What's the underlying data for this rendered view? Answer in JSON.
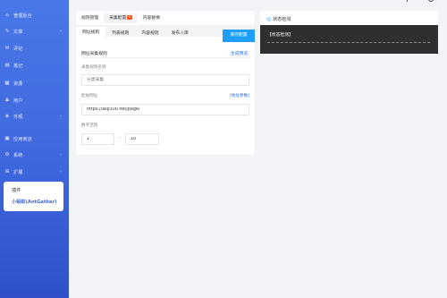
{
  "sidebar": {
    "items": [
      {
        "icon": "home-icon",
        "glyph": "⌂",
        "label": "管理后台"
      },
      {
        "icon": "pencil-icon",
        "glyph": "✎",
        "label": "文章",
        "arrow": true
      },
      {
        "icon": "comment-icon",
        "glyph": "✉",
        "label": "评论"
      },
      {
        "icon": "note-icon",
        "glyph": "▤",
        "label": "笔记"
      },
      {
        "icon": "resource-icon",
        "glyph": "▦",
        "label": "资源"
      },
      {
        "icon": "user-icon",
        "glyph": "♟",
        "label": "用户"
      },
      {
        "icon": "appearance-icon",
        "glyph": "◈",
        "label": "外观",
        "arrow": true
      },
      {
        "icon": "store-icon",
        "glyph": "▣",
        "label": "应用商店"
      },
      {
        "icon": "system-icon",
        "glyph": "⚙",
        "label": "系统",
        "arrow": true
      },
      {
        "icon": "extension-icon",
        "glyph": "⊞",
        "label": "扩展",
        "arrow": true
      }
    ],
    "submenu": [
      "插件",
      "小蚂蚁(AntGather)"
    ]
  },
  "tabs": {
    "primary": [
      {
        "label": "规则管理"
      },
      {
        "label": "采集配置",
        "badge": "1"
      },
      {
        "label": "内容替换"
      }
    ],
    "secondary": [
      "网址规则",
      "列表规则",
      "内容规则",
      "发布入库"
    ],
    "save_label": "保存配置"
  },
  "form": {
    "section_title": "网址采集规则",
    "generate_preview": "生成预览",
    "rule_name_label": "采集规则名称",
    "rule_name_placeholder": "分类采集",
    "start_url_label": "起始网址",
    "address_params": "[地址参数]",
    "start_url_value": "https://asp300.net/page/",
    "range_label": "数字范围",
    "range_from": "1",
    "range_separator": "-",
    "range_to": "10"
  },
  "status": {
    "title": "状态检测",
    "console_text": "【状态检测】"
  },
  "colors": {
    "sidebar_top": "#4a78e8",
    "sidebar_bottom": "#2f50c8",
    "primary_button": "#1e9fff",
    "badge": "#ff5722",
    "console_bg": "#2f2f2f"
  }
}
